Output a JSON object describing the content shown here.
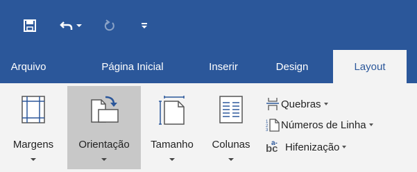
{
  "colors": {
    "accent": "#2b579a",
    "ribbon_bg": "#f3f3f3",
    "pressed_bg": "#c8c8c8"
  },
  "quick_access": [
    {
      "name": "save-icon"
    },
    {
      "name": "undo-icon"
    },
    {
      "name": "undo-dropdown-arrow"
    },
    {
      "name": "redo-icon"
    },
    {
      "name": "customize-qat-icon"
    }
  ],
  "tabs": [
    {
      "label": "Arquivo"
    },
    {
      "label": "Página Inicial"
    },
    {
      "label": "Inserir"
    },
    {
      "label": "Design"
    },
    {
      "label": "Layout",
      "active": true
    }
  ],
  "page_setup": {
    "margins_label": "Margens",
    "orientation_label": "Orientação",
    "size_label": "Tamanho",
    "columns_label": "Colunas",
    "breaks_label": "Quebras",
    "line_numbers_label": "Números de Linha",
    "hyphenation_label": "Hifenização",
    "hyphenation_icon_text": "bc",
    "hyphenation_icon_sup": "a-"
  }
}
